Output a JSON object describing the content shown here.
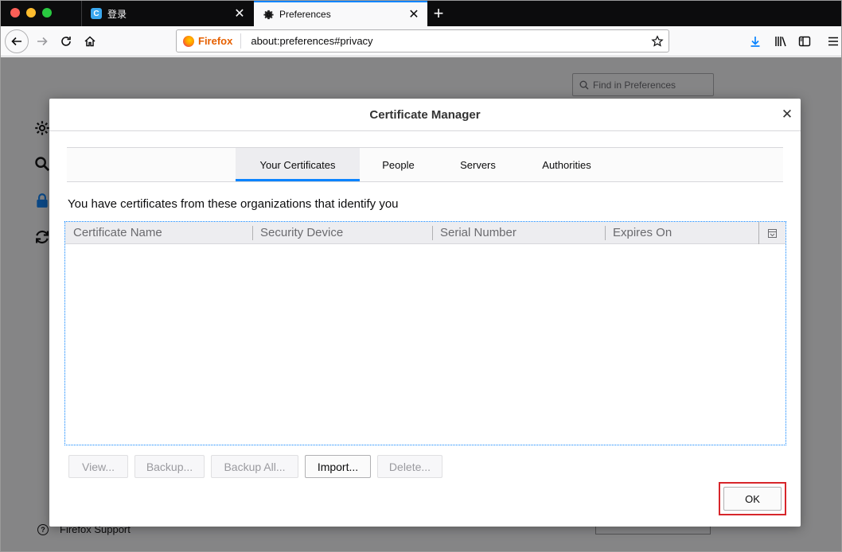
{
  "browser": {
    "tabs": [
      {
        "label": "登录",
        "icon": "c-app-favicon",
        "active": false
      },
      {
        "label": "Preferences",
        "icon": "gear-icon",
        "active": true
      }
    ],
    "url_identity": "Firefox",
    "url": "about:preferences#privacy"
  },
  "page": {
    "find_placeholder": "Find in Preferences",
    "support_label": "Firefox Support"
  },
  "dialog": {
    "title": "Certificate Manager",
    "tabs": [
      "Your Certificates",
      "People",
      "Servers",
      "Authorities"
    ],
    "selected_tab": "Your Certificates",
    "description": "You have certificates from these organizations that identify you",
    "columns": [
      "Certificate Name",
      "Security Device",
      "Serial Number",
      "Expires On"
    ],
    "rows": [],
    "buttons": [
      {
        "label": "View...",
        "enabled": false
      },
      {
        "label": "Backup...",
        "enabled": false
      },
      {
        "label": "Backup All...",
        "enabled": false
      },
      {
        "label": "Import...",
        "enabled": true
      },
      {
        "label": "Delete...",
        "enabled": false
      }
    ],
    "ok_label": "OK"
  },
  "colors": {
    "accent": "#0a84ff",
    "highlight_box": "#d7262b"
  }
}
